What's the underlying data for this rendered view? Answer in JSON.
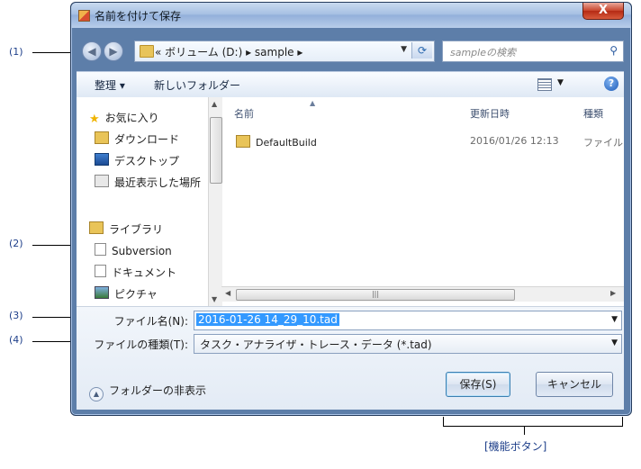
{
  "window": {
    "title": "名前を付けて保存",
    "close_label": "X"
  },
  "nav": {
    "address_text": "« ボリューム (D:)  ▸  sample  ▸",
    "search_placeholder": "sampleの検索"
  },
  "toolbar": {
    "organize_label": "整理 ▾",
    "new_folder_label": "新しいフォルダー"
  },
  "sidebar": {
    "items": [
      {
        "label": "お気に入り",
        "icon": "star-icon"
      },
      {
        "label": "ダウンロード",
        "icon": "download-folder-icon"
      },
      {
        "label": "デスクトップ",
        "icon": "desktop-icon"
      },
      {
        "label": "最近表示した場所",
        "icon": "recent-places-icon"
      },
      {
        "label": "ライブラリ",
        "icon": "libraries-icon"
      },
      {
        "label": "Subversion",
        "icon": "document-icon"
      },
      {
        "label": "ドキュメント",
        "icon": "documents-icon"
      },
      {
        "label": "ピクチャ",
        "icon": "pictures-icon"
      }
    ]
  },
  "file_list": {
    "columns": [
      "名前",
      "更新日時",
      "種類"
    ],
    "rows": [
      {
        "name": "DefaultBuild",
        "modified": "2016/01/26 12:13",
        "type": "ファイル"
      }
    ]
  },
  "form": {
    "filename_label": "ファイル名(N):",
    "filename_value": "2016-01-26 14_29_10.tad",
    "filetype_label": "ファイルの種類(T):",
    "filetype_value": "タスク・アナライザ・トレース・データ (*.tad)",
    "hide_folders_label": "フォルダーの非表示",
    "save_label": "保存(S)",
    "cancel_label": "キャンセル"
  },
  "annotations": {
    "callout_1": "(1)",
    "callout_2": "(2)",
    "callout_3": "(3)",
    "callout_4": "(4)",
    "function_buttons": "[機能ボタン]"
  }
}
